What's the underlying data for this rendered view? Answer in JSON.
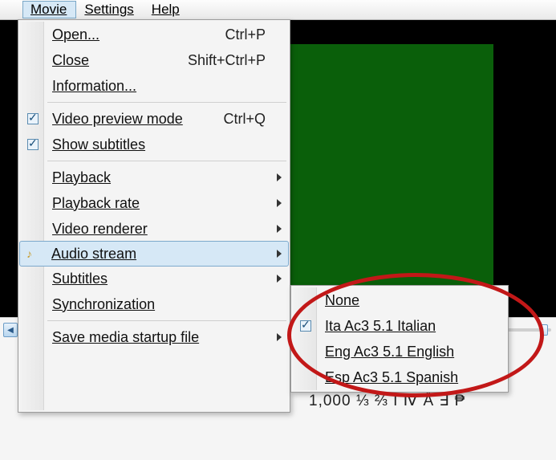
{
  "menubar": {
    "items": [
      "Movie",
      "Settings",
      "Help"
    ],
    "active_index": 0
  },
  "movie_menu": {
    "open": {
      "label": "Open...",
      "shortcut": "Ctrl+P"
    },
    "close": {
      "label": "Close",
      "shortcut": "Shift+Ctrl+P"
    },
    "info": {
      "label": "Information..."
    },
    "preview": {
      "label": "Video preview mode",
      "shortcut": "Ctrl+Q",
      "checked": true
    },
    "subs": {
      "label": "Show subtitles",
      "checked": true
    },
    "playback": {
      "label": "Playback"
    },
    "rate": {
      "label": "Playback rate"
    },
    "renderer": {
      "label": "Video renderer"
    },
    "audio": {
      "label": "Audio stream"
    },
    "subtitles": {
      "label": "Subtitles"
    },
    "sync": {
      "label": "Synchronization"
    },
    "savestart": {
      "label": "Save media startup file"
    }
  },
  "audio_submenu": {
    "none": {
      "label": "None"
    },
    "ita": {
      "label": "Ita Ac3 5.1 Italian",
      "checked": true
    },
    "eng": {
      "label": "Eng Ac3 5.1 English"
    },
    "esp": {
      "label": "Esp Ac3 5.1 Spanish"
    }
  },
  "status_line": "1,000  ⅓ ⅔ I Ⅳ Å ∃ ₱"
}
